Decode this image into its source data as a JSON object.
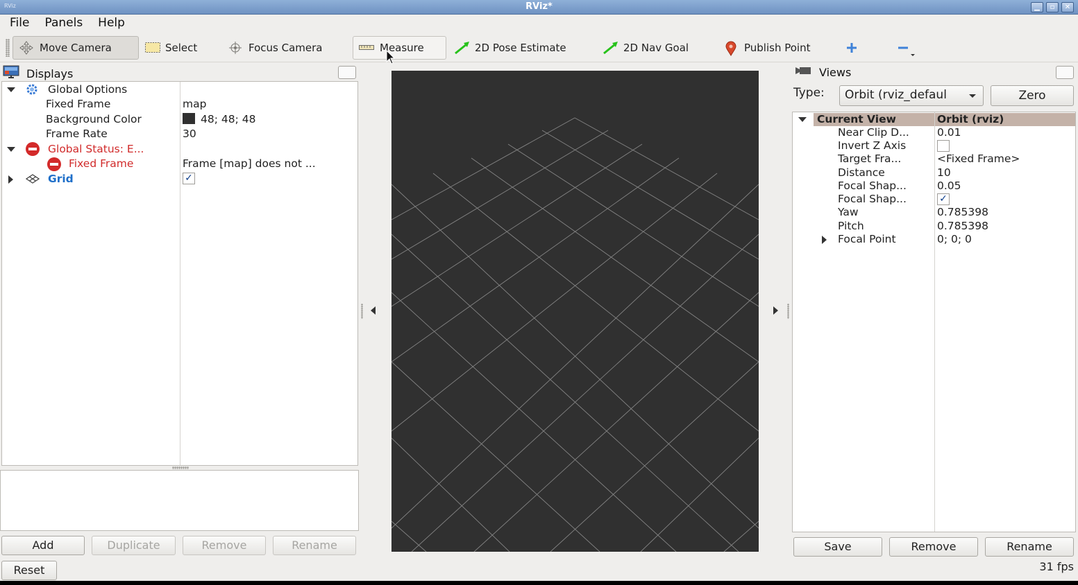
{
  "window": {
    "title": "RViz*",
    "app_icon_text": "RViz",
    "controls": {
      "minimize": "▁",
      "maximize": "▫",
      "close": "✕"
    }
  },
  "menu": [
    {
      "label": "File"
    },
    {
      "label": "Panels"
    },
    {
      "label": "Help"
    }
  ],
  "toolbar": {
    "move_camera": "Move Camera",
    "select": "Select",
    "focus_camera": "Focus Camera",
    "measure": "Measure",
    "pose_estimate": "2D Pose Estimate",
    "nav_goal": "2D Nav Goal",
    "publish_point": "Publish Point",
    "active_tool": "Move Camera"
  },
  "displays": {
    "title": "Displays",
    "global_options": {
      "label": "Global Options",
      "fixed_frame_label": "Fixed Frame",
      "fixed_frame_value": "map",
      "background_color_label": "Background Color",
      "background_color_value": "48; 48; 48",
      "background_color_hex": "#303030",
      "frame_rate_label": "Frame Rate",
      "frame_rate_value": "30"
    },
    "global_status": {
      "label": "Global Status: E...",
      "fixed_frame_label": "Fixed Frame",
      "fixed_frame_message": "Frame [map] does not ..."
    },
    "grid": {
      "label": "Grid",
      "enabled": true,
      "check": "✓"
    },
    "buttons": {
      "add": "Add",
      "duplicate": "Duplicate",
      "remove": "Remove",
      "rename": "Rename"
    }
  },
  "reset_label": "Reset",
  "views": {
    "title": "Views",
    "type_label": "Type:",
    "type_value": "Orbit (rviz_defaul",
    "zero_label": "Zero",
    "current_view": {
      "label": "Current View",
      "value": "Orbit (rviz)",
      "props": [
        {
          "key": "Near Clip D...",
          "value": "0.01"
        },
        {
          "key": "Invert Z Axis",
          "value": ""
        },
        {
          "key": "Target Fra...",
          "value": "<Fixed Frame>"
        },
        {
          "key": "Distance",
          "value": "10"
        },
        {
          "key": "Focal Shap...",
          "value": "0.05"
        },
        {
          "key": "Focal Shap...",
          "value": "✓"
        },
        {
          "key": "Yaw",
          "value": "0.785398"
        },
        {
          "key": "Pitch",
          "value": "0.785398"
        },
        {
          "key": "Focal Point",
          "value": "0; 0; 0"
        }
      ]
    },
    "buttons": {
      "save": "Save",
      "remove": "Remove",
      "rename": "Rename"
    }
  },
  "status": {
    "fps": "31 fps"
  },
  "colors": {
    "render_background": "#303030",
    "error": "#d32a2a",
    "link_blue": "#1f6fc9",
    "view_header": "#c4b2a8"
  }
}
